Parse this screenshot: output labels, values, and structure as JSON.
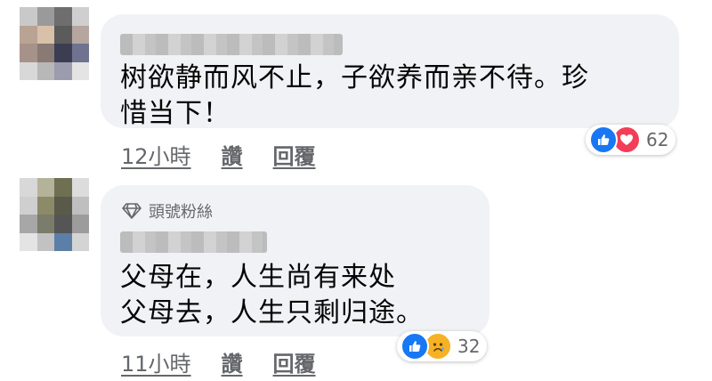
{
  "comments": [
    {
      "text_lines": [
        "树欲静而风不止，子欲养而亲不待。珍",
        "惜当下！"
      ],
      "time": "12小時",
      "like_label": "讚",
      "reply_label": "回覆",
      "reaction_count": "62",
      "reactions": [
        "like-icon",
        "love-icon"
      ]
    },
    {
      "badge": "頭號粉絲",
      "badge_icon": "diamond-icon",
      "text_lines": [
        "父母在，人生尚有来处",
        "父母去，人生只剩归途。"
      ],
      "time": "11小時",
      "like_label": "讚",
      "reply_label": "回覆",
      "reaction_count": "32",
      "reactions": [
        "like-icon",
        "sad-icon"
      ]
    }
  ],
  "colors": {
    "bubble": "#f0f2f5",
    "meta_text": "#65676b",
    "like_blue": "#1877f2",
    "love_red": "#f33e58",
    "sad_yellow": "#f7b125"
  }
}
